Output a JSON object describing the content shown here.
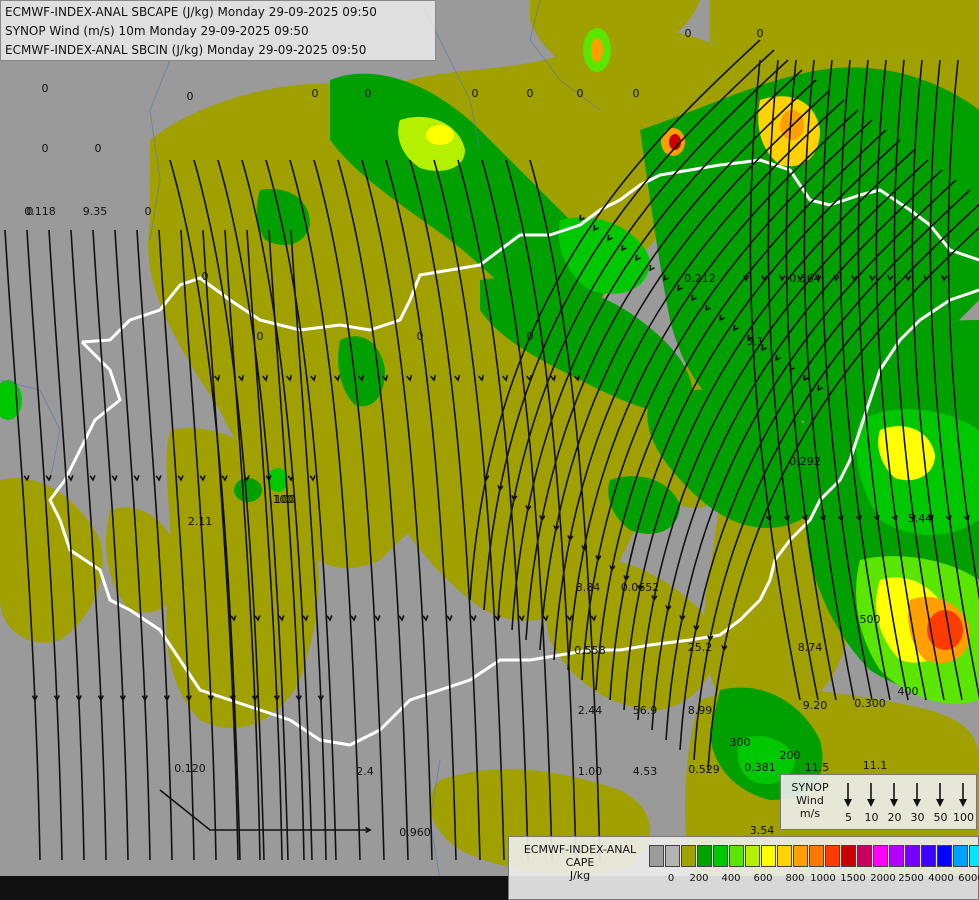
{
  "title_lines": [
    "ECMWF-INDEX-ANAL SBCAPE (J/kg) Monday 29-09-2025 09:50",
    "SYNOP Wind (m/s) 10m Monday 29-09-2025 09:50",
    "ECMWF-INDEX-ANAL SBCIN (J/kg) Monday 29-09-2025 09:50"
  ],
  "wind_legend": {
    "title": "SYNOP\nWind\nm/s",
    "title_lines": [
      "SYNOP",
      "Wind",
      "m/s"
    ],
    "speeds": [
      "5",
      "10",
      "20",
      "30",
      "50",
      "100"
    ]
  },
  "cape_legend": {
    "title_lines": [
      "ECMWF-INDEX-ANAL",
      "CAPE",
      "J/kg"
    ],
    "colors": [
      "#9c9c9c",
      "#b4b4b4",
      "#a0a000",
      "#00a000",
      "#00c800",
      "#5ae600",
      "#b4f000",
      "#ffff00",
      "#ffd200",
      "#ffa000",
      "#ff7800",
      "#ff3c00",
      "#c80000",
      "#c80064",
      "#ff00ff",
      "#b400ff",
      "#7800ff",
      "#3c00ff",
      "#0000ff",
      "#00a0ff",
      "#00e6ff",
      "#ffffff"
    ],
    "ticks": [
      "0",
      "200",
      "400",
      "600",
      "800",
      "1000",
      "1500",
      "2000",
      "2500",
      "4000",
      "6000"
    ]
  },
  "map_labels": [
    "0",
    "0",
    "0",
    "0",
    "0",
    "0",
    "0",
    "0",
    "0",
    "0",
    "0",
    "0",
    "0",
    "0",
    "0",
    "0",
    "0",
    "0",
    "0.118",
    "9.35",
    "2.11",
    "100",
    "8.84",
    "0.0652",
    "25.2",
    "8.74",
    "0.558",
    "2.44",
    "56.9",
    "8.99",
    "0.120",
    "2.4",
    "1.00",
    "4.53",
    "0.529",
    "0.381",
    "11.5",
    "11.1",
    "3.54",
    "0.300",
    "9.20",
    "0.292",
    "5.44",
    "0.212",
    "0.364",
    "5.1",
    "300",
    "200",
    "400",
    "500",
    "100",
    "0.960"
  ]
}
